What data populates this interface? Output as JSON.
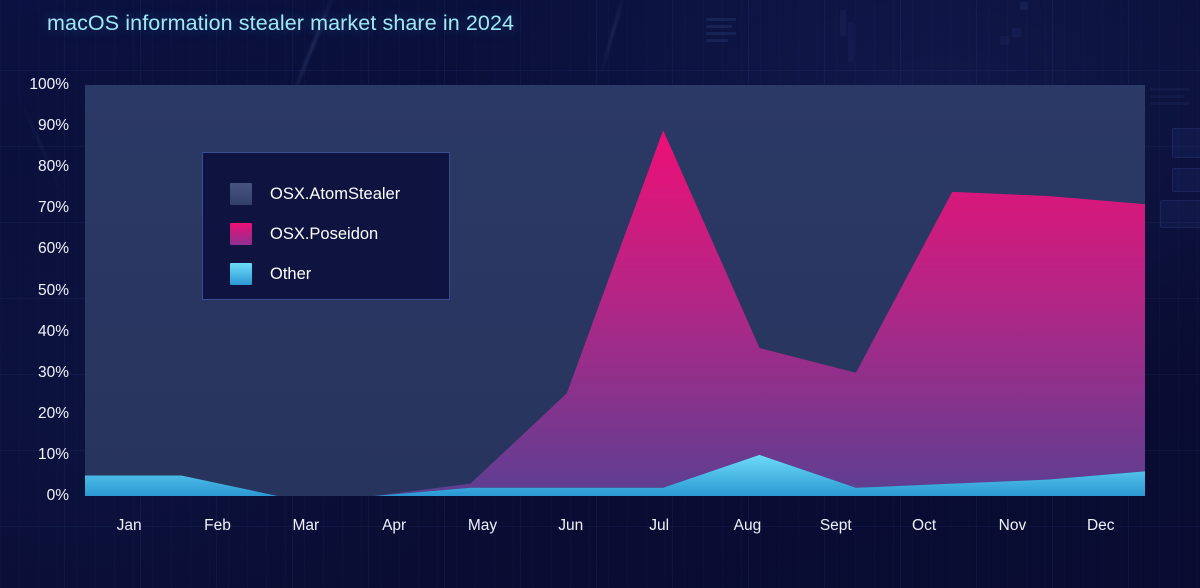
{
  "title": "macOS information stealer market share in 2024",
  "legend": {
    "items": [
      {
        "label": "OSX.AtomStealer",
        "color": "#3c4a78"
      },
      {
        "label": "OSX.Poseidon",
        "color": "#e01a74"
      },
      {
        "label": "Other",
        "color": "#44c8f0"
      }
    ]
  },
  "axes": {
    "y_ticks": [
      "100%",
      "90%",
      "80%",
      "70%",
      "60%",
      "50%",
      "40%",
      "30%",
      "20%",
      "10%",
      "0%"
    ],
    "x_ticks": [
      "Jan",
      "Feb",
      "Mar",
      "Apr",
      "May",
      "Jun",
      "Jul",
      "Aug",
      "Sept",
      "Oct",
      "Nov",
      "Dec"
    ]
  },
  "colors": {
    "background": "#0a0e34",
    "plot_background": "#28355f",
    "title": "#9fe8f5",
    "axis_text": "#f2f4fb",
    "atomstealer": "#3c4a78",
    "poseidon_top": "#ec1274",
    "poseidon_bottom": "#6a3a8c",
    "other_top": "#63d8f5",
    "other_bottom": "#2e9fd8",
    "legend_border": "#5c7ed7"
  },
  "chart_data": {
    "type": "area",
    "title": "macOS information stealer market share in 2024",
    "xlabel": "",
    "ylabel": "",
    "ylim": [
      0,
      100
    ],
    "stacked": true,
    "grid": false,
    "legend_position": "inside-upper-left",
    "categories": [
      "Jan",
      "Feb",
      "Mar",
      "Apr",
      "May",
      "Jun",
      "Jul",
      "Aug",
      "Sept",
      "Oct",
      "Nov",
      "Dec"
    ],
    "series": [
      {
        "name": "Other",
        "values": [
          5,
          5,
          0,
          0,
          2,
          2,
          2,
          10,
          2,
          3,
          4,
          6
        ]
      },
      {
        "name": "OSX.Poseidon",
        "values": [
          0,
          0,
          0,
          0,
          1,
          23,
          87,
          26,
          28,
          71,
          69,
          65
        ]
      },
      {
        "name": "OSX.AtomStealer",
        "values": [
          95,
          95,
          100,
          100,
          97,
          75,
          11,
          64,
          70,
          26,
          27,
          29
        ]
      }
    ],
    "cumulative_tops": {
      "Other": [
        5,
        5,
        0,
        0,
        2,
        2,
        2,
        10,
        2,
        3,
        4,
        6
      ],
      "Poseidon": [
        5,
        5,
        0,
        0,
        3,
        25,
        89,
        36,
        30,
        74,
        73,
        71
      ],
      "AtomStealer": [
        100,
        100,
        100,
        100,
        100,
        100,
        100,
        100,
        100,
        100,
        100,
        100
      ]
    }
  }
}
